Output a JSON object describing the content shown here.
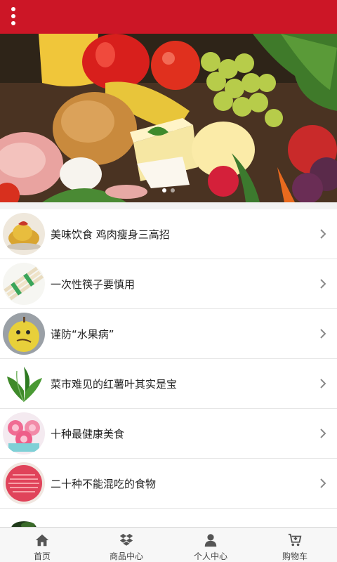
{
  "header": {
    "menu_icon": "more-vertical-icon",
    "color": "#cc1626"
  },
  "banner": {
    "slide_count": 2,
    "active_slide": 1,
    "image_subject": "vegetables, bread, cheese and fruit"
  },
  "articles": [
    {
      "title": "美味饮食 鸡肉瘦身三高招",
      "thumb": "chicken"
    },
    {
      "title": "一次性筷子要慎用",
      "thumb": "chopsticks"
    },
    {
      "title": "谨防“水果病”",
      "thumb": "pear"
    },
    {
      "title": "菜市难见的红薯叶其实是宝",
      "thumb": "leaves"
    },
    {
      "title": "十种最健康美食",
      "thumb": "cupcakes"
    },
    {
      "title": "二十种不能混吃的食物",
      "thumb": "shrimp"
    }
  ],
  "tabbar": {
    "tabs": [
      {
        "label": "首页",
        "icon": "home-icon"
      },
      {
        "label": "商品中心",
        "icon": "dropbox-icon"
      },
      {
        "label": "个人中心",
        "icon": "user-icon"
      },
      {
        "label": "购物车",
        "icon": "cart-icon"
      }
    ]
  }
}
